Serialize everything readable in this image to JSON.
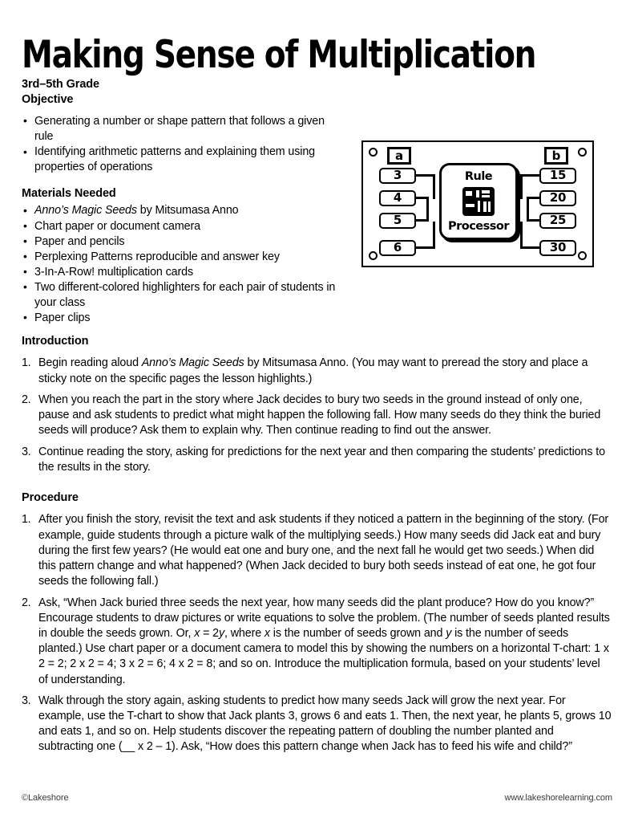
{
  "document": {
    "title": "Making Sense of Multiplication",
    "grade_level": "3rd–5th Grade"
  },
  "objective": {
    "heading": "Objective",
    "items": [
      "Generating a number or shape pattern that follows a given rule",
      "Identifying arithmetic patterns and explaining them using properties of operations"
    ]
  },
  "materials": {
    "heading": "Materials Needed",
    "items": [
      {
        "italic": "Anno’s Magic Seeds",
        "rest": " by Mitsumasa Anno"
      },
      {
        "italic": "",
        "rest": "Chart paper or document camera"
      },
      {
        "italic": "",
        "rest": "Paper and pencils"
      },
      {
        "italic": "",
        "rest": "Perplexing Patterns reproducible and answer key"
      },
      {
        "italic": "",
        "rest": "3-In-A-Row! multiplication cards"
      },
      {
        "italic": "",
        "rest": "Two different-colored highlighters for each pair of students in your class"
      },
      {
        "italic": "",
        "rest": "Paper clips"
      }
    ]
  },
  "introduction": {
    "heading": "Introduction",
    "items": [
      {
        "pre": "Begin reading aloud ",
        "italic": "Anno’s Magic Seeds",
        "post": " by Mitsumasa Anno. (You may want to preread the story and place a sticky note on the specific pages the lesson highlights.)"
      },
      {
        "pre": "When you reach the part in the story where Jack decides to bury two seeds in the ground instead of only one, pause and ask students to predict what might happen the following fall. How many seeds do they think the buried seeds will produce? Ask them to explain why. Then continue reading to find out the answer.",
        "italic": "",
        "post": ""
      },
      {
        "pre": "Continue reading the story, asking for predictions for the next year and then comparing the students’ predictions to the results in the story.",
        "italic": "",
        "post": ""
      }
    ]
  },
  "procedure": {
    "heading": "Procedure",
    "item1": "After you finish the story, revisit the text and ask students if they noticed a pattern in the beginning of the story. (For example, guide students through a picture walk of the multiplying seeds.) How many seeds did Jack eat and bury during the first few years? (He would eat one and bury one, and the next fall he would get two seeds.) When did this pattern change and what happened? (When Jack decided to bury both seeds instead of eat one, he got four seeds the following fall.)",
    "item2_a": "Ask, “When Jack buried three seeds the next year, how many seeds did the plant produce? How do you know?” Encourage students to draw pictures or write equations to solve the problem. (The number of seeds planted results in double the seeds grown. Or, ",
    "item2_var_x1": "x",
    "item2_b": " = 2",
    "item2_var_y1": "y",
    "item2_c": ", where ",
    "item2_var_x2": "x",
    "item2_d": " is the number of seeds grown and ",
    "item2_var_y2": "y",
    "item2_e": " is the number of seeds planted.) Use chart paper or a document camera to model this by showing the numbers on a horizontal T-chart: 1 x 2 = 2; 2 x 2 = 4; 3 x 2 = 6; 4 x 2 = 8; and so on. Introduce the multiplication formula, based on your students’ level of understanding.",
    "item3": "Walk through the story again, asking students to predict how many seeds Jack will grow the next year. For example, use the T-chart to show that Jack plants 3, grows 6 and eats 1. Then, the next year, he plants 5, grows 10 and eats 1, and so on. Help students discover the repeating pattern of doubling the number planted and subtracting one (__ x 2 – 1). Ask, “How does this pattern change when Jack has to feed his wife and child?”"
  },
  "diagram": {
    "name": "rule-processor-machine",
    "input_column_label": "a",
    "output_column_label": "b",
    "inputs": [
      "3",
      "4",
      "5",
      "6"
    ],
    "outputs": [
      "15",
      "20",
      "25",
      "30"
    ],
    "processor_top_word": "Rule",
    "processor_bottom_word": "Processor"
  },
  "footer": {
    "copyright": "©Lakeshore",
    "website": "www.lakeshorelearning.com"
  },
  "colors": {
    "ink": "#000000",
    "paper": "#ffffff",
    "footer_text": "#3a3a3a"
  }
}
